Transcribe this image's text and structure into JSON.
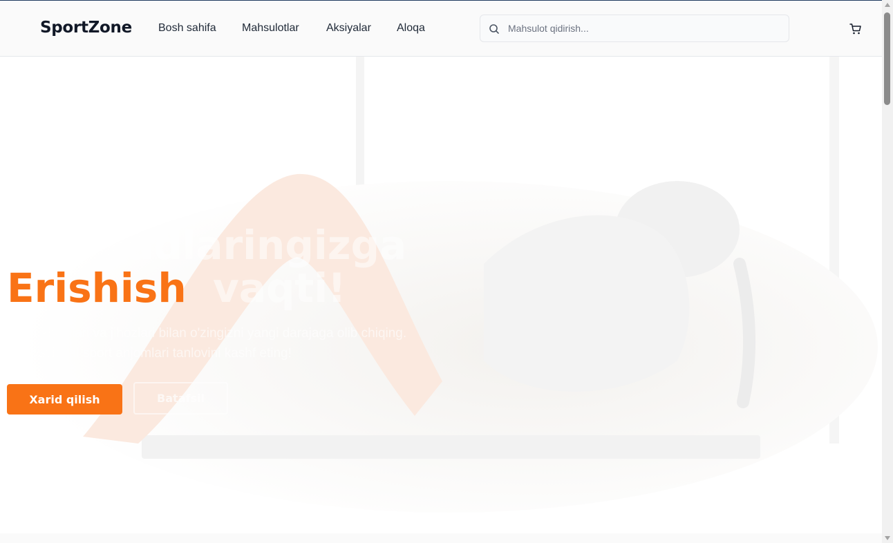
{
  "header": {
    "logo": "SportZone",
    "nav": [
      {
        "label": "Bosh sahifa"
      },
      {
        "label": "Mahsulotlar"
      },
      {
        "label": "Aksiyalar"
      },
      {
        "label": "Aloqa"
      }
    ],
    "search": {
      "placeholder": "Mahsulot qidirish...",
      "icon": "search-icon"
    },
    "cart": {
      "icon": "cart-icon"
    }
  },
  "hero": {
    "title_line1": "Maqsadlaringizga",
    "title_accent": "Erishish",
    "title_rest": "vaqti!",
    "subtitle": "Sport kiyimlari va jihozlari bilan o'zingizni yangi darajaga olib chiqing. Professional sport anjomlari tanlovini kashf eting!",
    "primary_button": "Xarid qilish",
    "secondary_button": "Batafsil"
  },
  "colors": {
    "accent": "#f97316",
    "header_bg": "#fafafa",
    "text": "#1f2937"
  }
}
